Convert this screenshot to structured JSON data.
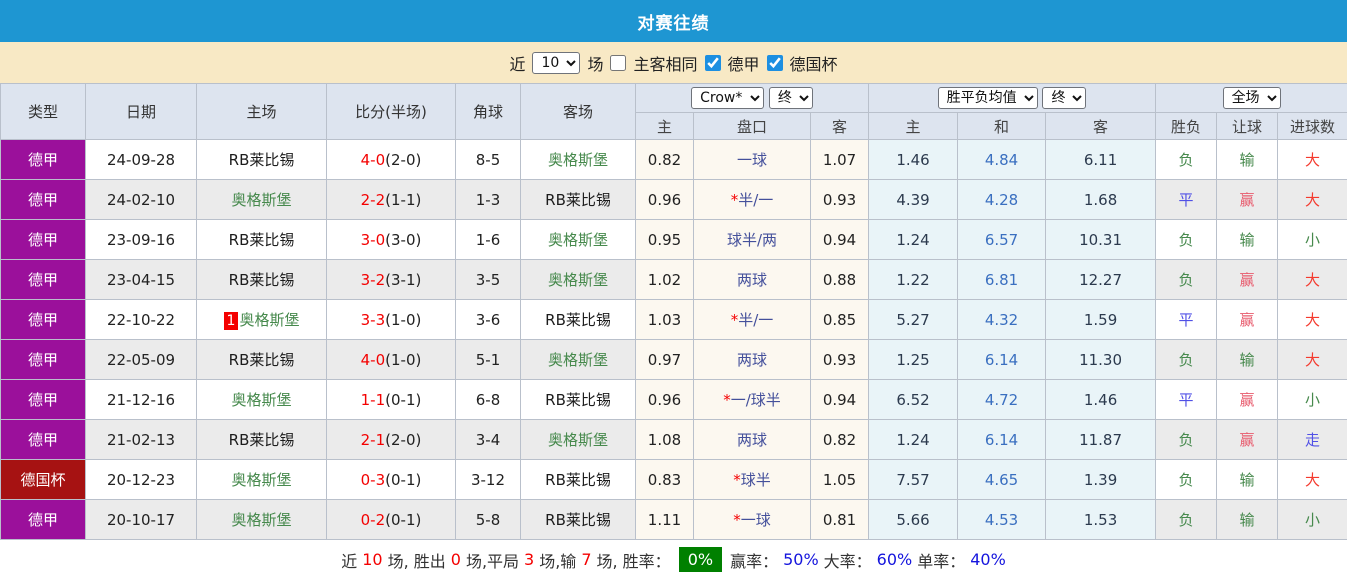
{
  "title": "对赛往绩",
  "filterbar": {
    "recent_label": "近",
    "recent_value": "10",
    "games_label": "场",
    "same_venue_label": "主客相同",
    "league_label": "德甲",
    "cup_label": "德国杯",
    "league_checked": "checked",
    "cup_checked": "checked"
  },
  "colors": {
    "titlebar_bg": "#1e96d2",
    "filterbar_bg": "#f8e9c5",
    "header_bg": "#dde4ef",
    "league_badge_bg": "#9b109b",
    "cup_badge_bg": "#a61212",
    "crow_cols_bg": "#fcf8f0",
    "avg_cols_bg": "#e9f4f8",
    "even_row_bg": "#ebebeb",
    "score_red": "#f40000",
    "team_green": "#46894c",
    "handicap_navy": "#44509b",
    "avg_draw_blue": "#3a6fc0",
    "result_green": "#46894c",
    "result_blue": "#5050e6",
    "result_red": "#f43a2e",
    "result_pink": "#e85c6e",
    "rate_box_green": "#008000",
    "pct_blue": "#1515dd"
  },
  "table": {
    "selects": {
      "bookmaker": "Crow*",
      "crow_time": "终",
      "avg_name": "胜平负均值",
      "avg_time": "终",
      "scope": "全场"
    },
    "headers": {
      "type": "类型",
      "date": "日期",
      "home": "主场",
      "score": "比分(半场)",
      "corners": "角球",
      "away": "客场",
      "crow_home": "主",
      "handicap": "盘口",
      "crow_away": "客",
      "avg_home": "主",
      "avg_draw": "和",
      "avg_away": "客",
      "res_wdl": "胜负",
      "res_handi": "让球",
      "res_goal": "进球数"
    },
    "rows": [
      {
        "type": "德甲",
        "type_class": "league",
        "date": "24-09-28",
        "home_badge": "",
        "home": "RB莱比锡",
        "home_class": "dark",
        "score": "4-0",
        "half": "(2-0)",
        "corners": "8-5",
        "away": "奥格斯堡",
        "away_class": "green",
        "crow_home": "0.82",
        "handicap_star": "",
        "handicap": "一球",
        "crow_away": "1.07",
        "avg_home": "1.46",
        "avg_draw": "4.84",
        "avg_away": "6.11",
        "res_wdl": "负",
        "res_wdl_class": "green",
        "res_handi": "输",
        "res_handi_class": "green",
        "res_goal": "大",
        "res_goal_class": "red"
      },
      {
        "type": "德甲",
        "type_class": "league",
        "date": "24-02-10",
        "home_badge": "",
        "home": "奥格斯堡",
        "home_class": "green",
        "score": "2-2",
        "half": "(1-1)",
        "corners": "1-3",
        "away": "RB莱比锡",
        "away_class": "dark",
        "crow_home": "0.96",
        "handicap_star": "*",
        "handicap": "半/一",
        "crow_away": "0.93",
        "avg_home": "4.39",
        "avg_draw": "4.28",
        "avg_away": "1.68",
        "res_wdl": "平",
        "res_wdl_class": "blue",
        "res_handi": "赢",
        "res_handi_class": "pink",
        "res_goal": "大",
        "res_goal_class": "red"
      },
      {
        "type": "德甲",
        "type_class": "league",
        "date": "23-09-16",
        "home_badge": "",
        "home": "RB莱比锡",
        "home_class": "dark",
        "score": "3-0",
        "half": "(3-0)",
        "corners": "1-6",
        "away": "奥格斯堡",
        "away_class": "green",
        "crow_home": "0.95",
        "handicap_star": "",
        "handicap": "球半/两",
        "crow_away": "0.94",
        "avg_home": "1.24",
        "avg_draw": "6.57",
        "avg_away": "10.31",
        "res_wdl": "负",
        "res_wdl_class": "green",
        "res_handi": "输",
        "res_handi_class": "green",
        "res_goal": "小",
        "res_goal_class": "green"
      },
      {
        "type": "德甲",
        "type_class": "league",
        "date": "23-04-15",
        "home_badge": "",
        "home": "RB莱比锡",
        "home_class": "dark",
        "score": "3-2",
        "half": "(3-1)",
        "corners": "3-5",
        "away": "奥格斯堡",
        "away_class": "green",
        "crow_home": "1.02",
        "handicap_star": "",
        "handicap": "两球",
        "crow_away": "0.88",
        "avg_home": "1.22",
        "avg_draw": "6.81",
        "avg_away": "12.27",
        "res_wdl": "负",
        "res_wdl_class": "green",
        "res_handi": "赢",
        "res_handi_class": "pink",
        "res_goal": "大",
        "res_goal_class": "red"
      },
      {
        "type": "德甲",
        "type_class": "league",
        "date": "22-10-22",
        "home_badge": "1",
        "home": "奥格斯堡",
        "home_class": "green",
        "score": "3-3",
        "half": "(1-0)",
        "corners": "3-6",
        "away": "RB莱比锡",
        "away_class": "dark",
        "crow_home": "1.03",
        "handicap_star": "*",
        "handicap": "半/一",
        "crow_away": "0.85",
        "avg_home": "5.27",
        "avg_draw": "4.32",
        "avg_away": "1.59",
        "res_wdl": "平",
        "res_wdl_class": "blue",
        "res_handi": "赢",
        "res_handi_class": "pink",
        "res_goal": "大",
        "res_goal_class": "red"
      },
      {
        "type": "德甲",
        "type_class": "league",
        "date": "22-05-09",
        "home_badge": "",
        "home": "RB莱比锡",
        "home_class": "dark",
        "score": "4-0",
        "half": "(1-0)",
        "corners": "5-1",
        "away": "奥格斯堡",
        "away_class": "green",
        "crow_home": "0.97",
        "handicap_star": "",
        "handicap": "两球",
        "crow_away": "0.93",
        "avg_home": "1.25",
        "avg_draw": "6.14",
        "avg_away": "11.30",
        "res_wdl": "负",
        "res_wdl_class": "green",
        "res_handi": "输",
        "res_handi_class": "green",
        "res_goal": "大",
        "res_goal_class": "red"
      },
      {
        "type": "德甲",
        "type_class": "league",
        "date": "21-12-16",
        "home_badge": "",
        "home": "奥格斯堡",
        "home_class": "green",
        "score": "1-1",
        "half": "(0-1)",
        "corners": "6-8",
        "away": "RB莱比锡",
        "away_class": "dark",
        "crow_home": "0.96",
        "handicap_star": "*",
        "handicap": "一/球半",
        "crow_away": "0.94",
        "avg_home": "6.52",
        "avg_draw": "4.72",
        "avg_away": "1.46",
        "res_wdl": "平",
        "res_wdl_class": "blue",
        "res_handi": "赢",
        "res_handi_class": "pink",
        "res_goal": "小",
        "res_goal_class": "green"
      },
      {
        "type": "德甲",
        "type_class": "league",
        "date": "21-02-13",
        "home_badge": "",
        "home": "RB莱比锡",
        "home_class": "dark",
        "score": "2-1",
        "half": "(2-0)",
        "corners": "3-4",
        "away": "奥格斯堡",
        "away_class": "green",
        "crow_home": "1.08",
        "handicap_star": "",
        "handicap": "两球",
        "crow_away": "0.82",
        "avg_home": "1.24",
        "avg_draw": "6.14",
        "avg_away": "11.87",
        "res_wdl": "负",
        "res_wdl_class": "green",
        "res_handi": "赢",
        "res_handi_class": "pink",
        "res_goal": "走",
        "res_goal_class": "blue"
      },
      {
        "type": "德国杯",
        "type_class": "cup",
        "date": "20-12-23",
        "home_badge": "",
        "home": "奥格斯堡",
        "home_class": "green",
        "score": "0-3",
        "half": "(0-1)",
        "corners": "3-12",
        "away": "RB莱比锡",
        "away_class": "dark",
        "crow_home": "0.83",
        "handicap_star": "*",
        "handicap": "球半",
        "crow_away": "1.05",
        "avg_home": "7.57",
        "avg_draw": "4.65",
        "avg_away": "1.39",
        "res_wdl": "负",
        "res_wdl_class": "green",
        "res_handi": "输",
        "res_handi_class": "green",
        "res_goal": "大",
        "res_goal_class": "red"
      },
      {
        "type": "德甲",
        "type_class": "league",
        "date": "20-10-17",
        "home_badge": "",
        "home": "奥格斯堡",
        "home_class": "green",
        "score": "0-2",
        "half": "(0-1)",
        "corners": "5-8",
        "away": "RB莱比锡",
        "away_class": "dark",
        "crow_home": "1.11",
        "handicap_star": "*",
        "handicap": "一球",
        "crow_away": "0.81",
        "avg_home": "5.66",
        "avg_draw": "4.53",
        "avg_away": "1.53",
        "res_wdl": "负",
        "res_wdl_class": "green",
        "res_handi": "输",
        "res_handi_class": "green",
        "res_goal": "小",
        "res_goal_class": "green"
      }
    ]
  },
  "summary": {
    "t1": "近",
    "n_total": "10",
    "t2": "场, 胜出",
    "n_win": "0",
    "t3": "场,平局",
    "n_draw": "3",
    "t4": "场,输",
    "n_lose": "7",
    "t5": "场, 胜率：",
    "win_rate": "0%",
    "t6": "赢率：",
    "win_pct": "50%",
    "t7": "大率：",
    "big_pct": "60%",
    "t8": "单率：",
    "single_pct": "40%"
  }
}
